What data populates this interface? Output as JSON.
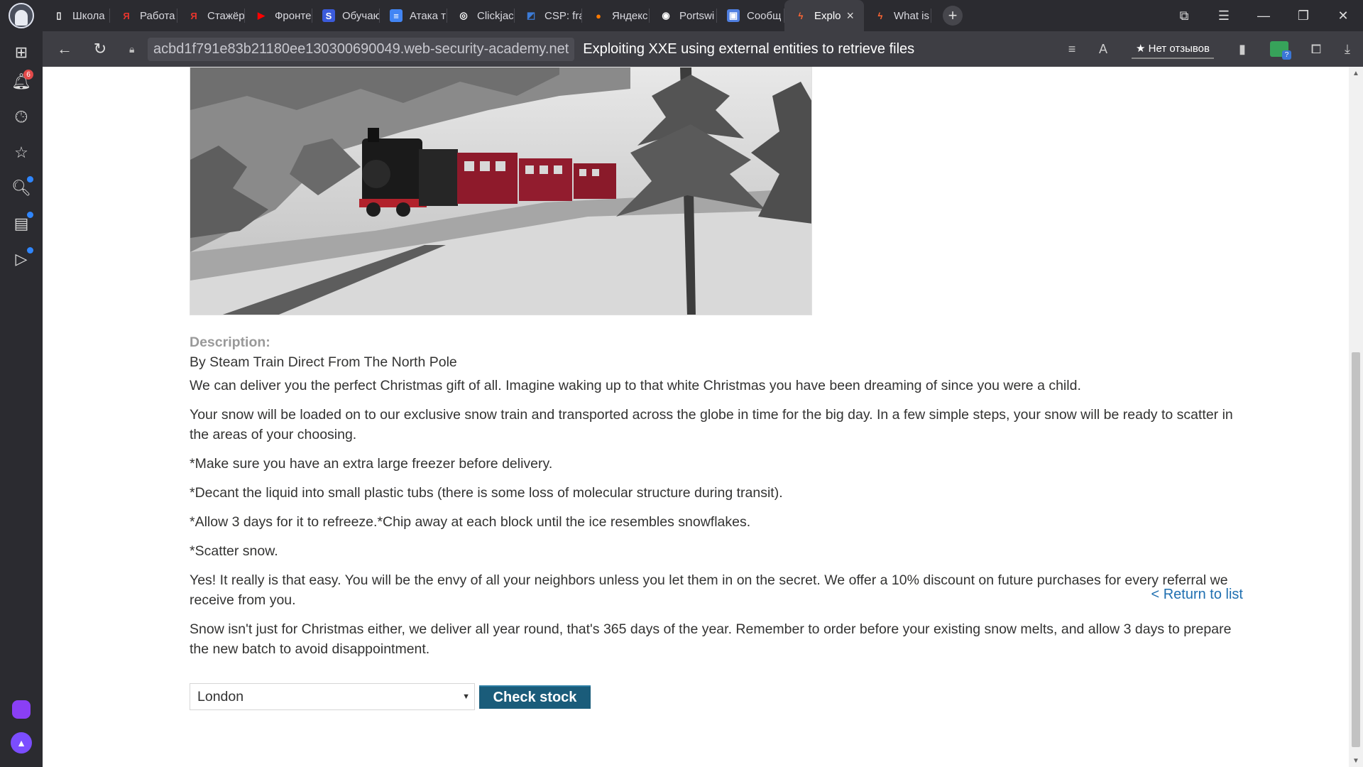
{
  "browser": {
    "tabs": [
      {
        "label": "Школа",
        "icon": "page-icon",
        "color": "#ffffff"
      },
      {
        "label": "Работа",
        "icon": "yandex-icon",
        "color": "#e8352d"
      },
      {
        "label": "Стажёр",
        "icon": "yandex-icon",
        "color": "#e8352d"
      },
      {
        "label": "Фронте",
        "icon": "youtube-icon",
        "color": "#ff0000"
      },
      {
        "label": "Обучаю",
        "icon": "s-icon",
        "color": "#3b5bdb"
      },
      {
        "label": "Атака т",
        "icon": "docs-icon",
        "color": "#4285f4"
      },
      {
        "label": "Clickjac",
        "icon": "clickjack-icon",
        "color": "#ffffff"
      },
      {
        "label": "CSP: fra",
        "icon": "csp-icon",
        "color": "#3c7bd6"
      },
      {
        "label": "Яндекс",
        "icon": "zen-icon",
        "color": "#ff7a00"
      },
      {
        "label": "Portswi",
        "icon": "github-icon",
        "color": "#ffffff"
      },
      {
        "label": "Сообщ",
        "icon": "chat-icon",
        "color": "#4f7fe0"
      },
      {
        "label": "Explo",
        "icon": "portswigger-icon",
        "color": "#ff6633",
        "active": true
      },
      {
        "label": "What is",
        "icon": "portswigger-icon",
        "color": "#ff6633"
      }
    ],
    "url_host": "acbd1f791e83b21180ee130300690049.web-security-academy.net",
    "page_title": "Exploiting XXE using external entities to retrieve files",
    "reviews_label": "Нет отзывов",
    "notification_count": "6"
  },
  "product": {
    "description_label": "Description:",
    "paragraphs": [
      "By Steam Train Direct From The North Pole",
      "We can deliver you the perfect Christmas gift of all. Imagine waking up to that white Christmas you have been dreaming of since you were a child.",
      "Your snow will be loaded on to our exclusive snow train and transported across the globe in time for the big day. In a few simple steps, your snow will be ready to scatter in the areas of your choosing.",
      "*Make sure you have an extra large freezer before delivery.",
      "*Decant the liquid into small plastic tubs (there is some loss of molecular structure during transit).",
      "*Allow 3 days for it to refreeze.*Chip away at each block until the ice resembles snowflakes.",
      "*Scatter snow.",
      "Yes! It really is that easy. You will be the envy of all your neighbors unless you let them in on the secret. We offer a 10% discount on future purchases for every referral we receive from you.",
      "Snow isn't just for Christmas either, we deliver all year round, that's 365 days of the year. Remember to order before your existing snow melts, and allow 3 days to prepare the new batch to avoid disappointment."
    ]
  },
  "stock": {
    "selected_store": "London",
    "check_label": "Check stock"
  },
  "return_label": "< Return to list"
}
